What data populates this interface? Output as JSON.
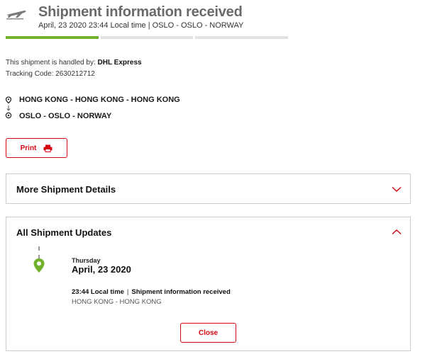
{
  "header": {
    "icon": "plane-icon",
    "title": "Shipment information received",
    "subtitle": "April, 23 2020 23:44 Local time | OSLO - OSLO - NORWAY"
  },
  "progress": {
    "segments": 3,
    "completed": 1,
    "color_done": "#71b12b",
    "color_pending": "#e2e2e2"
  },
  "details": {
    "handled_prefix": "This shipment is handled by:",
    "handled_by": "DHL Express",
    "tracking_label": "Tracking Code:",
    "tracking_code": "2630212712"
  },
  "route": {
    "origin": "HONG KONG - HONG KONG - HONG KONG",
    "destination": "OSLO - OSLO - NORWAY"
  },
  "print_button": {
    "label": "Print",
    "icon": "printer-icon"
  },
  "more_details_panel": {
    "title": "More Shipment Details",
    "state": "collapsed"
  },
  "updates_panel": {
    "title": "All Shipment Updates",
    "state": "expanded",
    "events": [
      {
        "day": "Thursday",
        "date": "April, 23 2020",
        "time": "23:44 Local time",
        "status": "Shipment information received",
        "location": "HONG KONG - HONG KONG"
      }
    ],
    "close_label": "Close"
  },
  "colors": {
    "brand_red": "#d40511",
    "accent_green": "#71b12b"
  }
}
